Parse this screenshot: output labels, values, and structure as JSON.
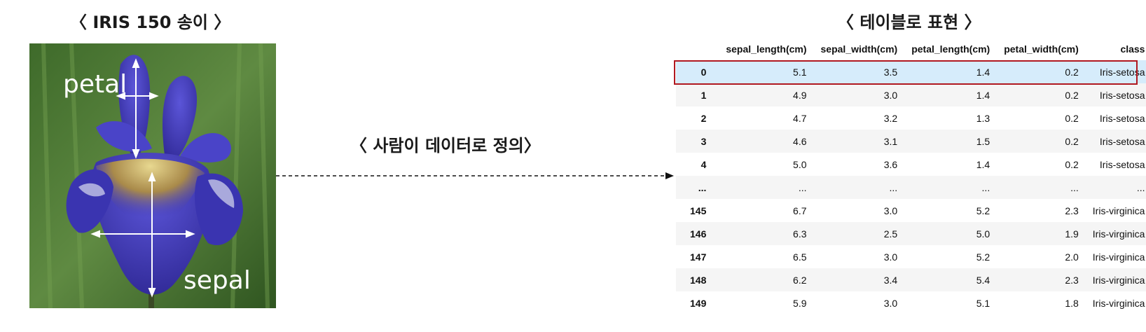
{
  "titles": {
    "left": "〈 IRIS 150 송이 〉",
    "middle": "〈 사람이 데이터로 정의〉",
    "right": "〈 테이블로 표현 〉"
  },
  "photo": {
    "labels": {
      "petal": "petal",
      "sepal": "sepal"
    }
  },
  "table": {
    "columns": [
      "",
      "sepal_length(cm)",
      "sepal_width(cm)",
      "petal_length(cm)",
      "petal_width(cm)",
      "class"
    ],
    "rows": [
      [
        "0",
        "5.1",
        "3.5",
        "1.4",
        "0.2",
        "Iris-setosa"
      ],
      [
        "1",
        "4.9",
        "3.0",
        "1.4",
        "0.2",
        "Iris-setosa"
      ],
      [
        "2",
        "4.7",
        "3.2",
        "1.3",
        "0.2",
        "Iris-setosa"
      ],
      [
        "3",
        "4.6",
        "3.1",
        "1.5",
        "0.2",
        "Iris-setosa"
      ],
      [
        "4",
        "5.0",
        "3.6",
        "1.4",
        "0.2",
        "Iris-setosa"
      ],
      [
        "...",
        "...",
        "...",
        "...",
        "...",
        "..."
      ],
      [
        "145",
        "6.7",
        "3.0",
        "5.2",
        "2.3",
        "Iris-virginica"
      ],
      [
        "146",
        "6.3",
        "2.5",
        "5.0",
        "1.9",
        "Iris-virginica"
      ],
      [
        "147",
        "6.5",
        "3.0",
        "5.2",
        "2.0",
        "Iris-virginica"
      ],
      [
        "148",
        "6.2",
        "3.4",
        "5.4",
        "2.3",
        "Iris-virginica"
      ],
      [
        "149",
        "5.9",
        "3.0",
        "5.1",
        "1.8",
        "Iris-virginica"
      ]
    ],
    "highlighted_row": 0
  },
  "colors": {
    "highlight_border": "#b01820",
    "highlight_fill": "#d6ecfb",
    "flower": "#3a34b0",
    "background_green": "#4d7a36"
  }
}
